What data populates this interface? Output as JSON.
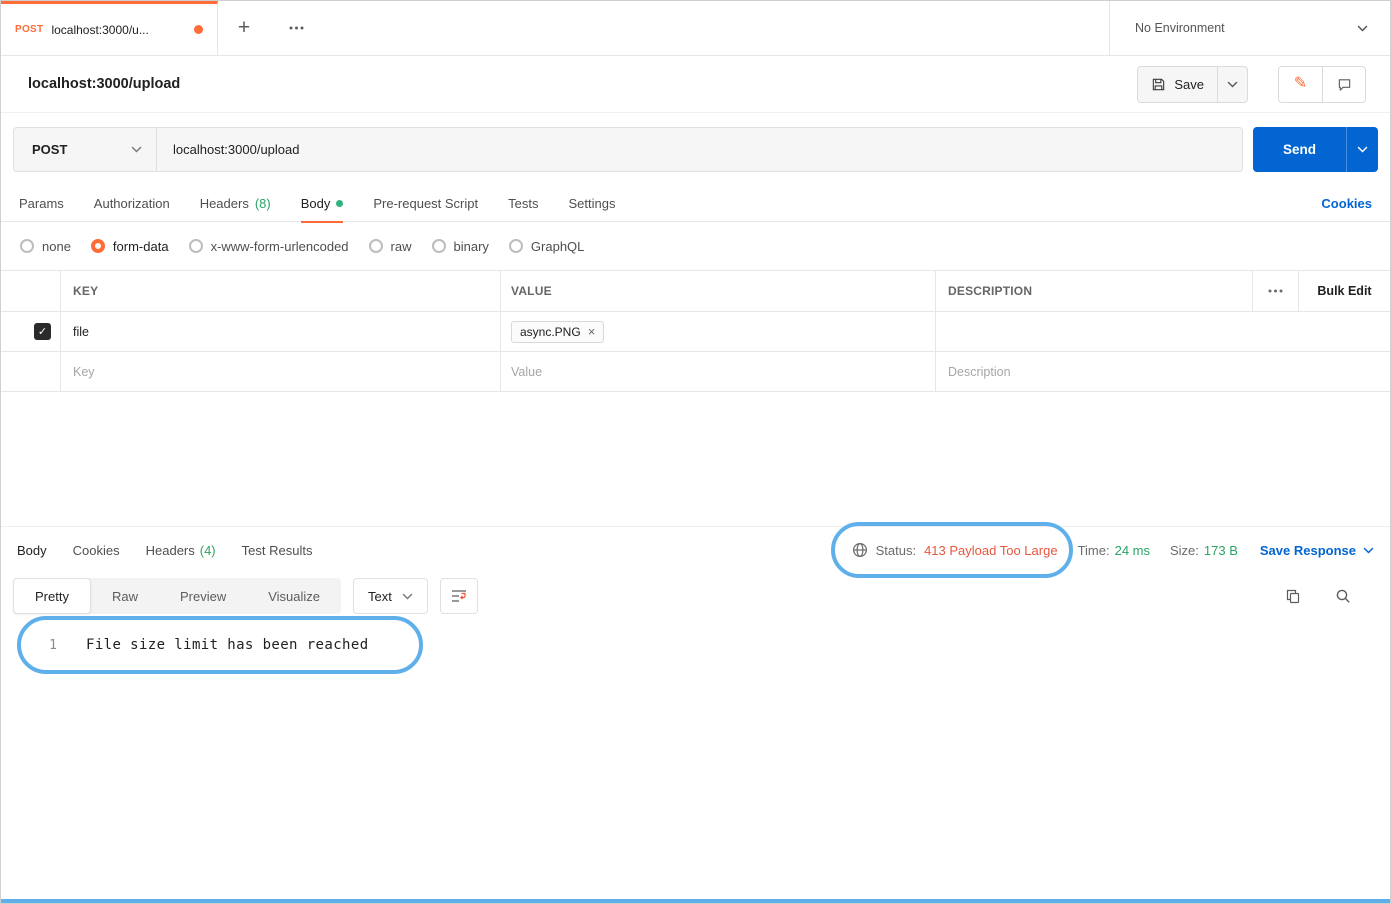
{
  "colors": {
    "accent_orange": "#ff6c37",
    "primary_blue": "#0265d2",
    "success_green": "#2aa464",
    "status_error": "#e8563e",
    "annotation_blue": "#5fb0ea"
  },
  "icons": {
    "new_tab": "+",
    "edit": "✎",
    "check": "✓",
    "close_chip": "×"
  },
  "topbar": {
    "tab_method": "POST",
    "tab_title": "localhost:3000/u...",
    "environment": "No Environment"
  },
  "request": {
    "title": "localhost:3000/upload",
    "save_label": "Save",
    "method": "POST",
    "url": "localhost:3000/upload",
    "send_label": "Send",
    "cookies_link": "Cookies",
    "tabs": {
      "params": "Params",
      "authorization": "Authorization",
      "headers": "Headers",
      "headers_count": "(8)",
      "body": "Body",
      "prerequest": "Pre-request Script",
      "tests": "Tests",
      "settings": "Settings"
    },
    "body_modes": [
      "none",
      "form-data",
      "x-www-form-urlencoded",
      "raw",
      "binary",
      "GraphQL"
    ],
    "selected_mode": "form-data"
  },
  "form_table": {
    "col_key": "KEY",
    "col_value": "VALUE",
    "col_description": "DESCRIPTION",
    "bulk_edit": "Bulk Edit",
    "row": {
      "key": "file",
      "file_chip": "async.PNG"
    },
    "placeholder": {
      "key": "Key",
      "value": "Value",
      "description": "Description"
    }
  },
  "response": {
    "tabs": {
      "body": "Body",
      "cookies": "Cookies",
      "headers": "Headers",
      "headers_count": "(4)",
      "test_results": "Test Results"
    },
    "status_label": "Status:",
    "status_value": "413 Payload Too Large",
    "time_label": "Time:",
    "time_value": "24 ms",
    "size_label": "Size:",
    "size_value": "173 B",
    "save_response": "Save Response",
    "view_tabs": [
      "Pretty",
      "Raw",
      "Preview",
      "Visualize"
    ],
    "active_view_tab": "Pretty",
    "format_select": "Text",
    "line_number": "1",
    "body_text": "File size limit has been reached"
  }
}
